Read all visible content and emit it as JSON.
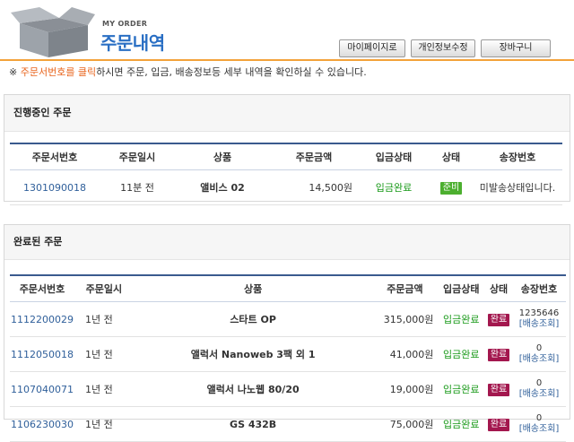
{
  "header": {
    "subtitle": "MY ORDER",
    "title": "주문내역",
    "buttons": [
      "마이페이지로",
      "개인정보수정",
      "장바구니"
    ]
  },
  "notice": {
    "prefix": "※ ",
    "highlight": "주문서번호를 클릭",
    "rest": "하시면 주문, 입금, 배송정보등 세부 내역을 확인하실 수 있습니다."
  },
  "in_progress": {
    "title": "진행중인 주문",
    "columns": [
      "주문서번호",
      "주문일시",
      "상품",
      "주문금액",
      "입금상태",
      "상태",
      "송장번호"
    ],
    "rows": [
      {
        "order_no": "1301090018",
        "date": "11분 전",
        "product": "앨비스 02",
        "amount": "14,500원",
        "payment": "입금완료",
        "status": "준비",
        "tracking": "미발송상태입니다."
      }
    ]
  },
  "completed": {
    "title": "완료된 주문",
    "columns": [
      "주문서번호",
      "주문일시",
      "상품",
      "주문금액",
      "입금상태",
      "상태",
      "송장번호"
    ],
    "lookup_label": "[배송조회]",
    "rows": [
      {
        "order_no": "1112200029",
        "date": "1년 전",
        "product": "스타트 OP",
        "amount": "315,000원",
        "payment": "입금완료",
        "status": "완료",
        "tracking": "1235646"
      },
      {
        "order_no": "1112050018",
        "date": "1년 전",
        "product": "앨럭서 Nanoweb 3팩 외 1",
        "amount": "41,000원",
        "payment": "입금완료",
        "status": "완료",
        "tracking": "0"
      },
      {
        "order_no": "1107040071",
        "date": "1년 전",
        "product": "앨럭서 나노웹 80/20",
        "amount": "19,000원",
        "payment": "입금완료",
        "status": "완료",
        "tracking": "0"
      },
      {
        "order_no": "1106230030",
        "date": "1년 전",
        "product": "GS 432B",
        "amount": "75,000원",
        "payment": "입금완료",
        "status": "완료",
        "tracking": "0"
      }
    ]
  },
  "colors": {
    "accent": "#2a6fc4",
    "header_line": "#f3a23a",
    "table_rule": "#3a5a8e",
    "ready": "#4caf2f",
    "done": "#a3174e",
    "paid": "#1a9a1a"
  }
}
